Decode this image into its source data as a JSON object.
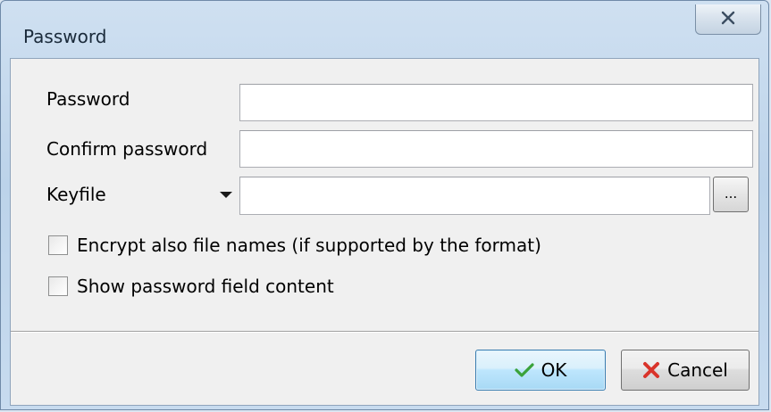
{
  "window": {
    "title": "Password",
    "close_glyph": "☒"
  },
  "form": {
    "password_label": "Password",
    "password_value": "",
    "confirm_label": "Confirm password",
    "confirm_value": "",
    "keyfile_label": "Keyfile",
    "keyfile_value": "",
    "browse_label": "..."
  },
  "options": {
    "encrypt_names_label": "Encrypt also file names (if supported by the format)",
    "encrypt_names_checked": false,
    "show_password_label": "Show password field content",
    "show_password_checked": false
  },
  "buttons": {
    "ok_label": "OK",
    "cancel_label": "Cancel"
  },
  "icons": {
    "ok": "check-icon",
    "cancel": "x-icon",
    "close": "close-icon",
    "keyfile_menu": "chevron-down-icon"
  },
  "colors": {
    "ok_check": "#3aa23a",
    "cancel_x": "#d9342b",
    "title_bar": "#c7dbef"
  }
}
